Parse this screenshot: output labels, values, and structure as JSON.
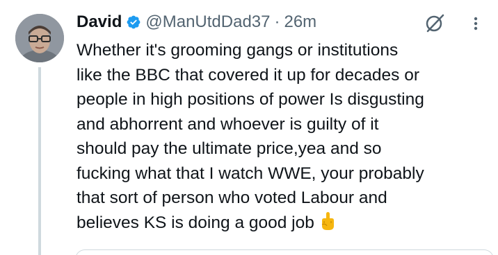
{
  "post": {
    "author": {
      "display_name": "David",
      "handle": "@ManUtdDad37",
      "separator": "·",
      "timestamp": "26m",
      "verified": true,
      "avatar_icon": "avatar-person-glasses"
    },
    "text_lines": [
      "Whether it's grooming gangs or institutions",
      "like the BBC that covered it up for decades or",
      "people in high positions of power Is disgusting",
      "and abhorrent and whoever is guilty of it",
      "should pay the ultimate price,yea and so",
      "fucking what that I watch WWE, your probably",
      "that sort of person who voted Labour and",
      "believes KS is doing a good job"
    ],
    "trailing_emoji": "middle-finger-emoji",
    "icons": {
      "verified": "verified-badge-icon",
      "grok": "grok-icon",
      "more": "more-options-icon"
    },
    "colors": {
      "text": "#0f1419",
      "secondary": "#536471",
      "verified_blue": "#1d9bf0",
      "thread_line": "#cfd9de"
    }
  }
}
